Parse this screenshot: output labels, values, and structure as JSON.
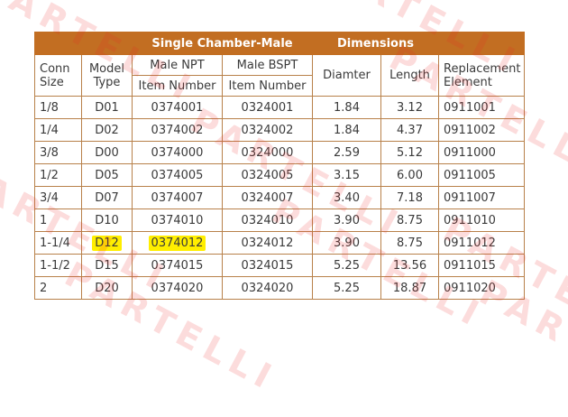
{
  "watermark": "PARTELLI",
  "table": {
    "group_headers": {
      "single_chamber": "Single Chamber-Male",
      "dimensions": "Dimensions"
    },
    "columns": {
      "conn_size": "Conn Size",
      "model_type": "Model Type",
      "male_npt": "Male NPT",
      "male_bspt": "Male BSPT",
      "item_number_npt": "Item Number",
      "item_number_bspt": "Item Number",
      "diameter": "Diamter",
      "length": "Length",
      "replacement_element": "Replacement Element"
    },
    "rows": [
      {
        "conn": "1/8",
        "model": "D01",
        "npt": "0374001",
        "bspt": "0324001",
        "dia": "1.84",
        "len": "3.12",
        "rep": "0911001",
        "highlight": false
      },
      {
        "conn": "1/4",
        "model": "D02",
        "npt": "0374002",
        "bspt": "0324002",
        "dia": "1.84",
        "len": "4.37",
        "rep": "0911002",
        "highlight": false
      },
      {
        "conn": "3/8",
        "model": "D00",
        "npt": "0374000",
        "bspt": "0324000",
        "dia": "2.59",
        "len": "5.12",
        "rep": "0911000",
        "highlight": false
      },
      {
        "conn": "1/2",
        "model": "D05",
        "npt": "0374005",
        "bspt": "0324005",
        "dia": "3.15",
        "len": "6.00",
        "rep": "0911005",
        "highlight": false
      },
      {
        "conn": "3/4",
        "model": "D07",
        "npt": "0374007",
        "bspt": "0324007",
        "dia": "3.40",
        "len": "7.18",
        "rep": "0911007",
        "highlight": false
      },
      {
        "conn": "1",
        "model": "D10",
        "npt": "0374010",
        "bspt": "0324010",
        "dia": "3.90",
        "len": "8.75",
        "rep": "0911010",
        "highlight": false
      },
      {
        "conn": "1-1/4",
        "model": "D12",
        "npt": "0374012",
        "bspt": "0324012",
        "dia": "3.90",
        "len": "8.75",
        "rep": "0911012",
        "highlight": true
      },
      {
        "conn": "1-1/2",
        "model": "D15",
        "npt": "0374015",
        "bspt": "0324015",
        "dia": "5.25",
        "len": "13.56",
        "rep": "0911015",
        "highlight": false
      },
      {
        "conn": "2",
        "model": "D20",
        "npt": "0374020",
        "bspt": "0324020",
        "dia": "5.25",
        "len": "18.87",
        "rep": "0911020",
        "highlight": false
      }
    ]
  },
  "colors": {
    "header_band": "#c26e22",
    "grid_line": "#b8814a",
    "highlight": "#ffee00",
    "watermark": "#eb2828"
  }
}
